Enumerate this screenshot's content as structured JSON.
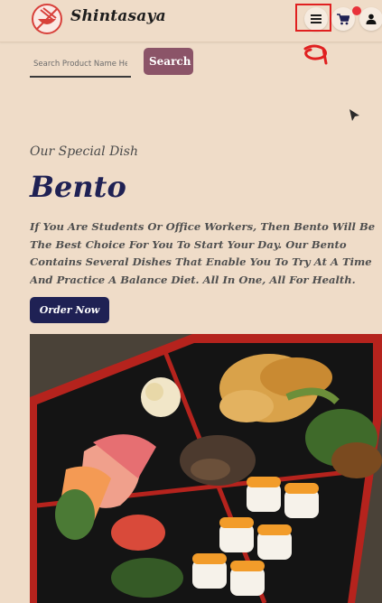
{
  "header": {
    "brand": "Shintasaya",
    "logo_icon": "chopsticks-bowl-logo",
    "menu_icon": "hamburger-menu-icon",
    "cart_icon": "shopping-cart-icon",
    "user_icon": "user-icon",
    "cart_badge_color": "#e8313a",
    "highlight_color": "#e02020"
  },
  "search": {
    "placeholder": "Search Product Name Here",
    "button_label": "Search",
    "button_color": "#8b5468"
  },
  "hero": {
    "eyebrow": "Our Special Dish",
    "title": "Bento",
    "description": "If You Are Students Or Office Workers, Then Bento Will Be The Best Choice For You To Start Your Day. Our Bento Contains Several Dishes That Enable You To Try At A Time And Practice A Balance Diet. All In One, All For Health.",
    "order_label": "Order Now",
    "accent_color": "#1f2154"
  },
  "image": {
    "icon": "bento-box-photo"
  }
}
